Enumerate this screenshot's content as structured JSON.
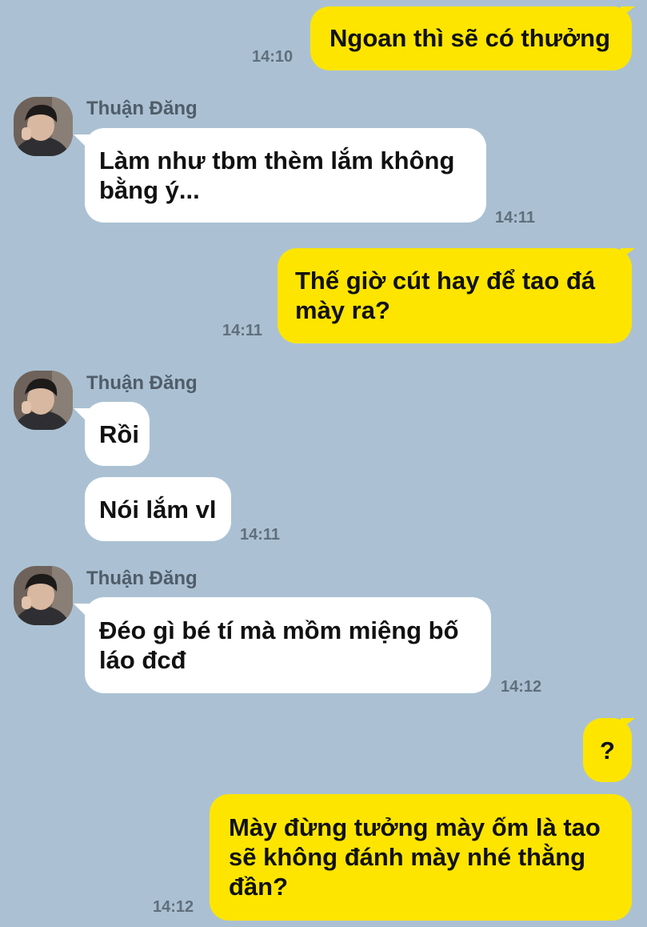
{
  "messages": [
    {
      "id": "m1",
      "from": "me",
      "text": "Ngoan thì sẽ có thưởng",
      "time": "14:10"
    },
    {
      "id": "m2",
      "from": "them",
      "sender": "Thuận Đăng",
      "text": "Làm như tbm thèm lắm không bằng ý...",
      "time": "14:11"
    },
    {
      "id": "m3",
      "from": "me",
      "text": "Thế giờ cút hay để tao đá mày ra?",
      "time": "14:11"
    },
    {
      "id": "m4",
      "from": "them",
      "sender": "Thuận Đăng",
      "text": "Rồi",
      "time": ""
    },
    {
      "id": "m5",
      "from": "them",
      "text": "Nói lắm vl",
      "time": "14:11"
    },
    {
      "id": "m6",
      "from": "them",
      "sender": "Thuận Đăng",
      "text": "Đéo gì bé tí mà mồm miệng bố láo đcđ",
      "time": "14:12"
    },
    {
      "id": "m7",
      "from": "me",
      "text": "?",
      "time": ""
    },
    {
      "id": "m8",
      "from": "me",
      "text": "Mày đừng tưởng mày ốm là tao sẽ không đánh mày nhé thằng đần?",
      "time": "14:12"
    }
  ],
  "colors": {
    "background": "#abc1d3",
    "my_bubble": "#fde500",
    "their_bubble": "#ffffff"
  }
}
